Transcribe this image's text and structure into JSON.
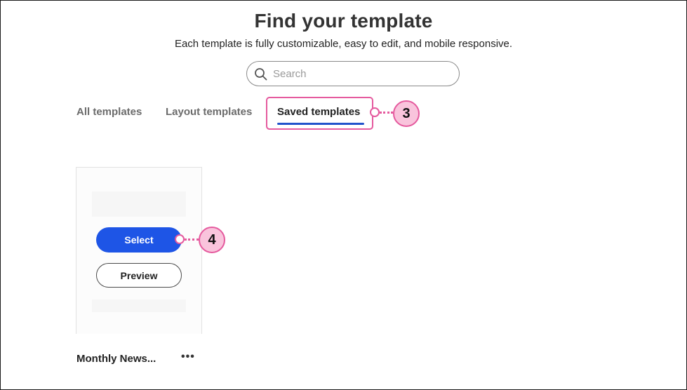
{
  "header": {
    "title": "Find your template",
    "subtitle": "Each template is fully customizable, easy to edit, and mobile responsive."
  },
  "search": {
    "placeholder": "Search",
    "value": "",
    "icon": "search-icon"
  },
  "tabs": [
    {
      "label": "All templates",
      "active": false
    },
    {
      "label": "Layout templates",
      "active": false
    },
    {
      "label": "Saved templates",
      "active": true
    }
  ],
  "callouts": [
    {
      "number": "3",
      "target": "Saved templates tab"
    },
    {
      "number": "4",
      "target": "Select button"
    }
  ],
  "template_card": {
    "name": "Monthly News...",
    "select_label": "Select",
    "preview_label": "Preview",
    "menu_label": "•••"
  },
  "colors": {
    "accent": "#1e55e6",
    "tab_underline": "#2153cc",
    "callout": "#e55a9e",
    "callout_fill": "#f9c4dc"
  }
}
